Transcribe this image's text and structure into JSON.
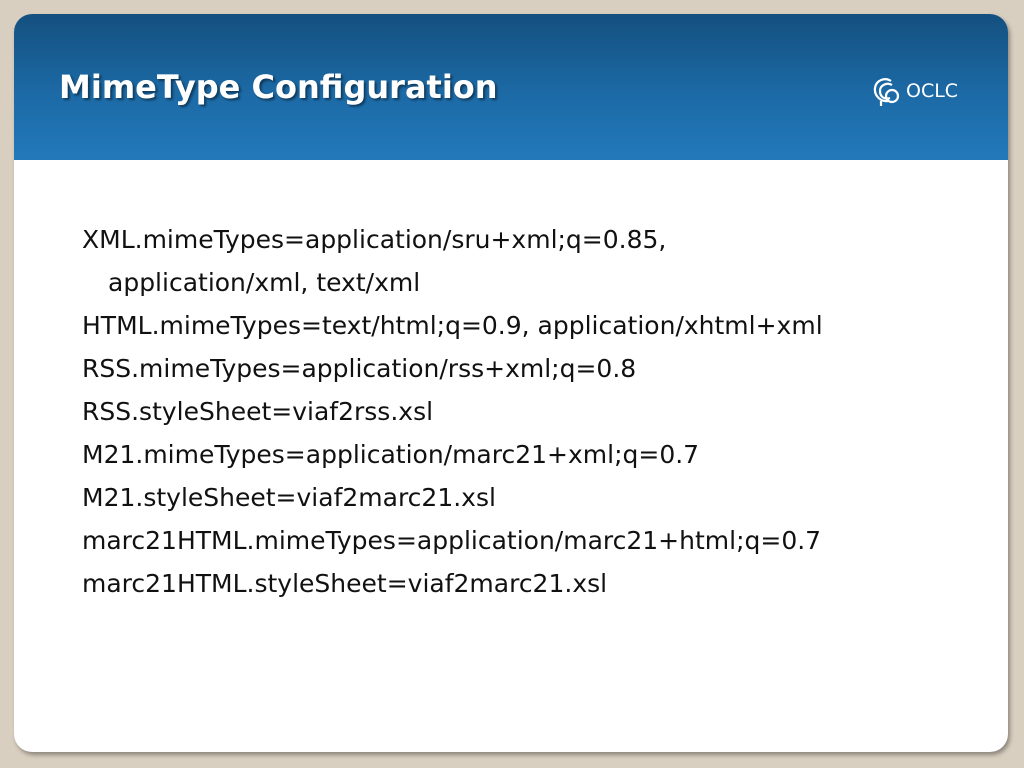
{
  "slide": {
    "title": "MimeType Configuration",
    "logo_text": "OCLC",
    "logo_icon": "oclc-logo-icon",
    "lines": [
      "XML.mimeTypes=application/sru+xml;q=0.85,",
      "application/xml, text/xml",
      "HTML.mimeTypes=text/html;q=0.9, application/xhtml+xml",
      "RSS.mimeTypes=application/rss+xml;q=0.8",
      "RSS.styleSheet=viaf2rss.xsl",
      "M21.mimeTypes=application/marc21+xml;q=0.7",
      "M21.styleSheet=viaf2marc21.xsl",
      "marc21HTML.mimeTypes=application/marc21+html;q=0.7",
      "marc21HTML.styleSheet=viaf2marc21.xsl"
    ]
  },
  "colors": {
    "header_top": "#14507f",
    "header_bottom": "#2279ba",
    "frame": "#d9cfc0",
    "text": "#111111"
  }
}
